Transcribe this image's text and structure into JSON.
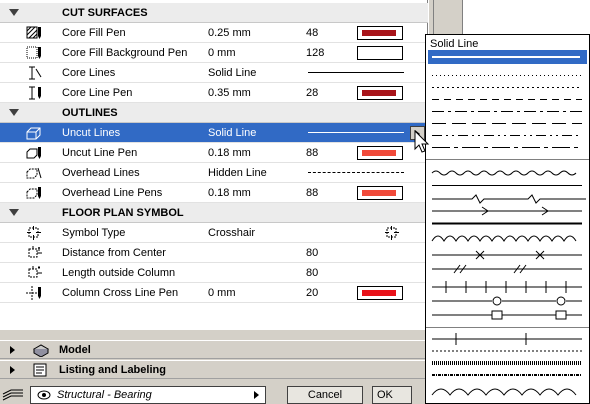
{
  "sections": [
    {
      "title": "CUT SURFACES"
    },
    {
      "title": "OUTLINES"
    },
    {
      "title": "FLOOR PLAN SYMBOL"
    }
  ],
  "rows": {
    "core_fill_pen": {
      "label": "Core Fill Pen",
      "value": "0.25 mm",
      "number": "48",
      "swatch_color": "#a8141a"
    },
    "core_fill_bg_pen": {
      "label": "Core Fill Background Pen",
      "value": "0 mm",
      "number": "128",
      "swatch_color": "#ffffff"
    },
    "core_lines": {
      "label": "Core Lines",
      "value": "Solid Line"
    },
    "core_line_pen": {
      "label": "Core Line Pen",
      "value": "0.35 mm",
      "number": "28",
      "swatch_color": "#a8141a"
    },
    "uncut_lines": {
      "label": "Uncut Lines",
      "value": "Solid Line"
    },
    "uncut_line_pen": {
      "label": "Uncut Line Pen",
      "value": "0.18 mm",
      "number": "88",
      "swatch_color": "#f04a3a"
    },
    "overhead_lines": {
      "label": "Overhead Lines",
      "value": "Hidden Line"
    },
    "overhead_line_pens": {
      "label": "Overhead Line Pens",
      "value": "0.18 mm",
      "number": "88",
      "swatch_color": "#f04a3a"
    },
    "symbol_type": {
      "label": "Symbol Type",
      "value": "Crosshair"
    },
    "distance_from_center": {
      "label": "Distance from Center",
      "number": "80"
    },
    "length_outside_column": {
      "label": "Length outside Column",
      "number": "80"
    },
    "column_cross_line_pen": {
      "label": "Column Cross Line Pen",
      "value": "0 mm",
      "number": "20",
      "swatch_color": "#e8121a"
    }
  },
  "groups": {
    "model": "Model",
    "listing": "Listing and Labeling"
  },
  "footer": {
    "favorite": "Structural - Bearing",
    "cancel": "Cancel",
    "ok": "OK"
  },
  "popup": {
    "title": "Solid Line",
    "selected": "Solid Line"
  }
}
